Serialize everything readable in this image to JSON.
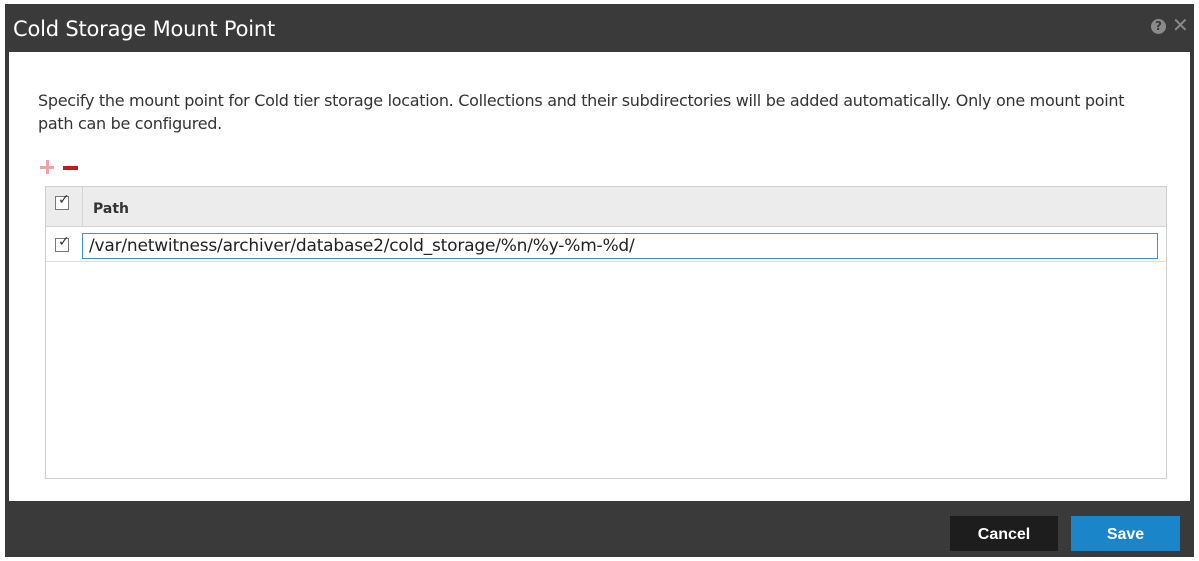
{
  "dialog": {
    "title": "Cold Storage Mount Point",
    "help_icon": "question-circle-icon",
    "close_icon": "close-icon"
  },
  "description": "Specify the mount point for Cold tier storage location. Collections and their subdirectories will be added automatically. Only one mount point path can be configured.",
  "toolbar": {
    "add_icon": "plus-icon",
    "remove_icon": "minus-icon"
  },
  "grid": {
    "columns": [
      "Path"
    ],
    "header_checked": true,
    "rows": [
      {
        "checked": true,
        "path": "/var/netwitness/archiver/database2/cold_storage/%n/%y-%m-%d/"
      }
    ]
  },
  "buttons": {
    "cancel": "Cancel",
    "save": "Save"
  },
  "colors": {
    "titlebar": "#3a3a3a",
    "add_icon": "#f0a3a3",
    "remove_icon": "#c0181d",
    "save_button": "#1a86c9",
    "cancel_button": "#1d1d1d",
    "input_focus_border": "#3d91d2"
  }
}
